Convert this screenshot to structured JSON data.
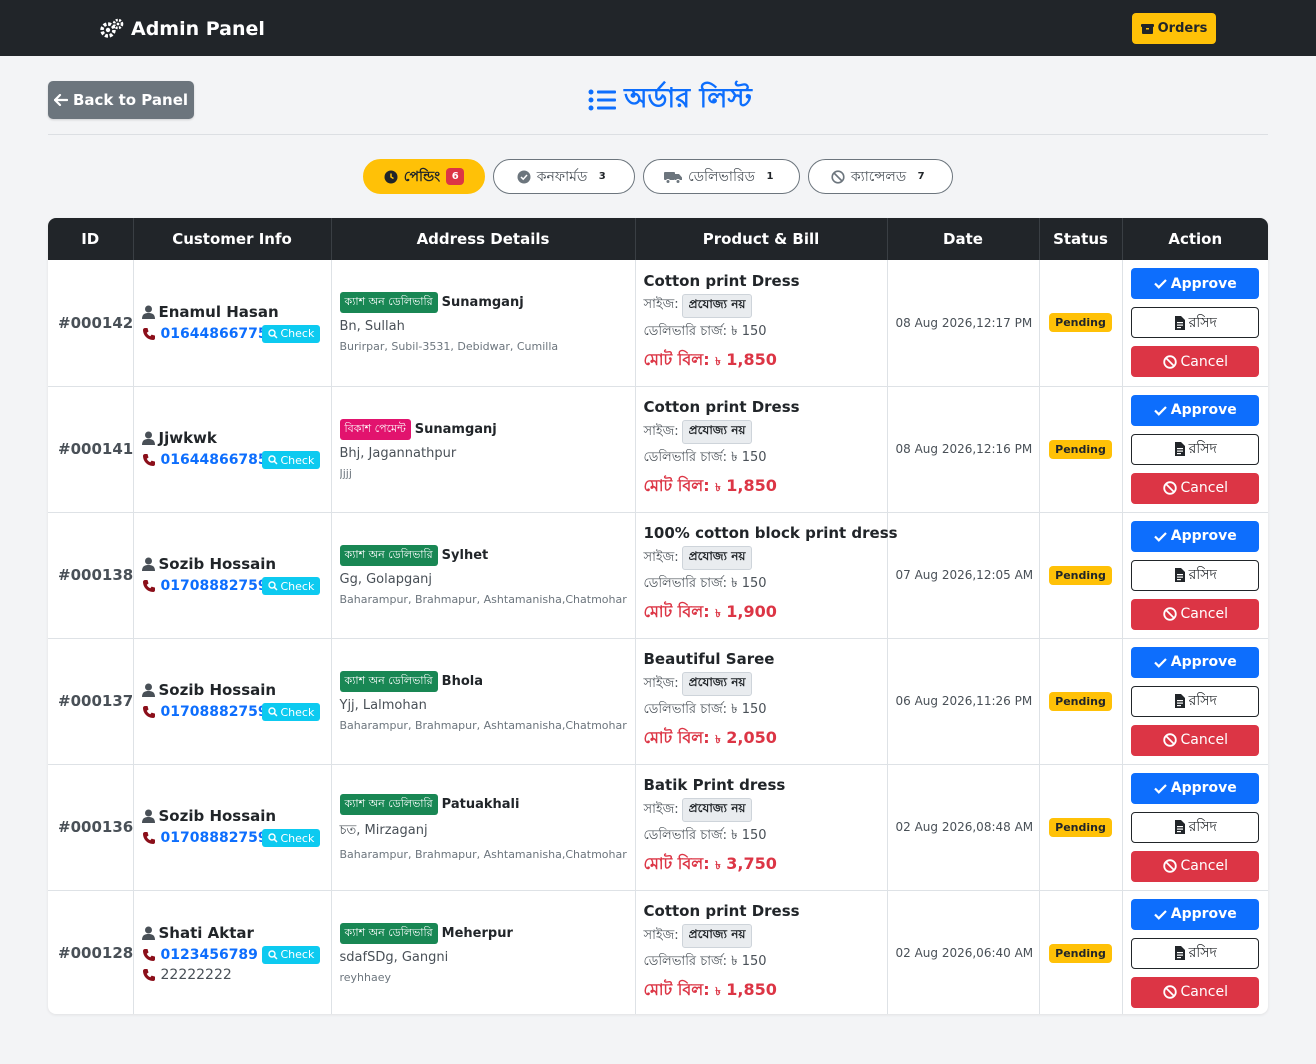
{
  "navbar": {
    "brand": "Admin Panel",
    "orders_label": "Orders"
  },
  "header": {
    "back_label": "Back to Panel",
    "title": "অর্ডার লিস্ট"
  },
  "tabs": [
    {
      "label": "পেন্ডিং",
      "count": "6"
    },
    {
      "label": "কনফার্মড",
      "count": "3"
    },
    {
      "label": "ডেলিভারিড",
      "count": "1"
    },
    {
      "label": "ক্যান্সেলড",
      "count": "7"
    }
  ],
  "table": {
    "headers": [
      "ID",
      "Customer Info",
      "Address Details",
      "Product & Bill",
      "Date",
      "Status",
      "Action"
    ],
    "check_label": "Check",
    "size_prefix": "সাইজ:",
    "size_value": "প্রযোজ্য নয়",
    "charge_prefix": "ডেলিভারি চার্জ: ৳",
    "total_prefix": "মোট বিল:",
    "currency": "৳",
    "status_label": "Pending",
    "approve_label": "Approve",
    "receipt_label": "রসিদ",
    "cancel_label": "Cancel",
    "rows": [
      {
        "id": "#000142",
        "name": "Enamul Hasan",
        "phone": "01644866775",
        "phone2": "",
        "payment": "ক্যাশ অন ডেলিভারি",
        "district": "Sunamganj",
        "address": "Bn, Sullah",
        "address_full": "Burirpar, Subil-3531, Debidwar, Cumilla",
        "product": "Cotton print Dress",
        "delivery_charge": "150",
        "total": "1,850",
        "date": "08 Aug 2026,12:17 PM"
      },
      {
        "id": "#000141",
        "name": "Jjwkwk",
        "phone": "01644866785",
        "phone2": "",
        "payment": "বিকাশ পেমেন্ট",
        "district": "Sunamganj",
        "address": "Bhj, Jagannathpur",
        "address_full": "Jjjj",
        "product": "Cotton print Dress",
        "delivery_charge": "150",
        "total": "1,850",
        "date": "08 Aug 2026,12:16 PM"
      },
      {
        "id": "#000138",
        "name": "Sozib Hossain",
        "phone": "01708882759",
        "phone2": "",
        "payment": "ক্যাশ অন ডেলিভারি",
        "district": "Sylhet",
        "address": "Gg, Golapganj",
        "address_full": "Baharampur, Brahmapur, Ashtamanisha,Chatmohar",
        "product": "100% cotton block print dress",
        "delivery_charge": "150",
        "total": "1,900",
        "date": "07 Aug 2026,12:05 AM"
      },
      {
        "id": "#000137",
        "name": "Sozib Hossain",
        "phone": "01708882759",
        "phone2": "",
        "payment": "ক্যাশ অন ডেলিভারি",
        "district": "Bhola",
        "address": "Yjj, Lalmohan",
        "address_full": "Baharampur, Brahmapur, Ashtamanisha,Chatmohar",
        "product": "Beautiful Saree",
        "delivery_charge": "150",
        "total": "2,050",
        "date": "06 Aug 2026,11:26 PM"
      },
      {
        "id": "#000136",
        "name": "Sozib Hossain",
        "phone": "01708882759",
        "phone2": "",
        "payment": "ক্যাশ অন ডেলিভারি",
        "district": "Patuakhali",
        "address": "চত, Mirzaganj",
        "address_full": "Baharampur, Brahmapur, Ashtamanisha,Chatmohar",
        "product": "Batik Print dress",
        "delivery_charge": "150",
        "total": "3,750",
        "date": "02 Aug 2026,08:48 AM"
      },
      {
        "id": "#000128",
        "name": "Shati Aktar",
        "phone": "0123456789",
        "phone2": "22222222",
        "payment": "ক্যাশ অন ডেলিভারি",
        "district": "Meherpur",
        "address": "sdafSDg, Gangni",
        "address_full": "reyhhaey",
        "product": "Cotton print Dress",
        "delivery_charge": "150",
        "total": "1,850",
        "date": "02 Aug 2026,06:40 AM"
      }
    ]
  },
  "colors": {
    "navbar": "#212529",
    "primary": "#0d6efd",
    "warning": "#ffc107",
    "danger": "#dc3545",
    "info": "#0dcaf0",
    "success": "#198754",
    "bkash": "#e2136e"
  },
  "icons": [
    "gears-icon",
    "box-icon",
    "arrow-left-icon",
    "list-icon",
    "clock-icon",
    "check-circle-icon",
    "truck-icon",
    "ban-icon",
    "user-icon",
    "phone-icon",
    "search-icon",
    "check-icon",
    "file-icon"
  ]
}
